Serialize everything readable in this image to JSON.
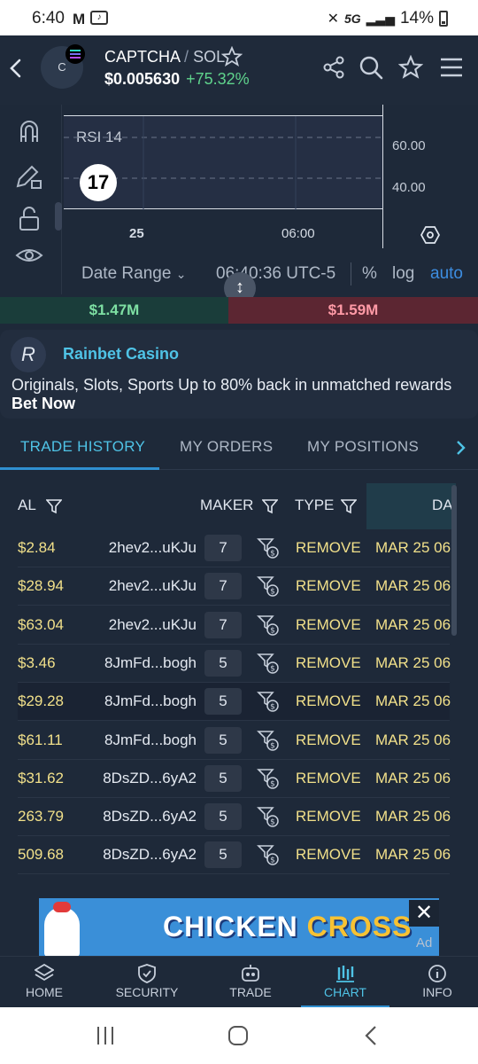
{
  "status": {
    "time": "6:40",
    "network": "5G",
    "battery": "14%"
  },
  "header": {
    "avatar_letter": "C",
    "base": "CAPTCHA",
    "separator": "/",
    "quote": "SOL",
    "price": "$0.005630",
    "change": "+75.32%",
    "icons": [
      "back-icon",
      "share-icon",
      "search-icon",
      "star-icon",
      "menu-icon"
    ]
  },
  "chart": {
    "indicator_label": "RSI 14",
    "y_ticks": [
      "60.00",
      "40.00"
    ],
    "x_ticks": [
      "25",
      "06:00"
    ],
    "controls": {
      "date_range": "Date Range",
      "time": "06:40:36 UTC-5",
      "percent": "%",
      "log": "log",
      "auto": "auto"
    },
    "tools": [
      "magnet-icon",
      "pencil-lock-icon",
      "unlock-icon",
      "eye-icon"
    ],
    "colors": {
      "accent": "#3d8de0"
    }
  },
  "volume": {
    "buys": "$1.47M",
    "sells": "$1.59M",
    "buy_color": "#7ee0a3",
    "sell_color": "#ff9aa6"
  },
  "ad": {
    "title": "Rainbet Casino",
    "text": "Originals, Slots, Sports Up to 80% back in unmatched rewards",
    "cta": "Bet Now"
  },
  "tabs": {
    "items": [
      "TRADE HISTORY",
      "MY ORDERS",
      "MY POSITIONS"
    ],
    "active": "TRADE HISTORY"
  },
  "table": {
    "headers": {
      "value": "AL",
      "maker": "MAKER",
      "type": "TYPE",
      "date": "DA"
    },
    "rows": [
      {
        "value": "$2.84",
        "maker": "2hev2...uKJu",
        "count": "7",
        "type": "REMOVE",
        "date": "MAR 25 06"
      },
      {
        "value": "$28.94",
        "maker": "2hev2...uKJu",
        "count": "7",
        "type": "REMOVE",
        "date": "MAR 25 06"
      },
      {
        "value": "$63.04",
        "maker": "2hev2...uKJu",
        "count": "7",
        "type": "REMOVE",
        "date": "MAR 25 06"
      },
      {
        "value": "$3.46",
        "maker": "8JmFd...bogh",
        "count": "5",
        "type": "REMOVE",
        "date": "MAR 25 06"
      },
      {
        "value": "$29.28",
        "maker": "8JmFd...bogh",
        "count": "5",
        "type": "REMOVE",
        "date": "MAR 25 06"
      },
      {
        "value": "$61.11",
        "maker": "8JmFd...bogh",
        "count": "5",
        "type": "REMOVE",
        "date": "MAR 25 06"
      },
      {
        "value": "$31.62",
        "maker": "8DsZD...6yA2",
        "count": "5",
        "type": "REMOVE",
        "date": "MAR 25 06"
      },
      {
        "value": "263.79",
        "maker": "8DsZD...6yA2",
        "count": "5",
        "type": "REMOVE",
        "date": "MAR 25 06"
      },
      {
        "value": "509.68",
        "maker": "8DsZD...6yA2",
        "count": "5",
        "type": "REMOVE",
        "date": "MAR 25 06"
      }
    ]
  },
  "game_ad": {
    "word1": "CHICKEN",
    "word2": "CROSS",
    "tag": "Ad",
    "close": "✕"
  },
  "bottom_nav": {
    "items": [
      {
        "label": "HOME",
        "icon": "home-icon"
      },
      {
        "label": "SECURITY",
        "icon": "shield-icon"
      },
      {
        "label": "TRADE",
        "icon": "robot-icon"
      },
      {
        "label": "CHART",
        "icon": "chart-icon"
      },
      {
        "label": "INFO",
        "icon": "info-icon"
      }
    ],
    "active": "CHART"
  }
}
